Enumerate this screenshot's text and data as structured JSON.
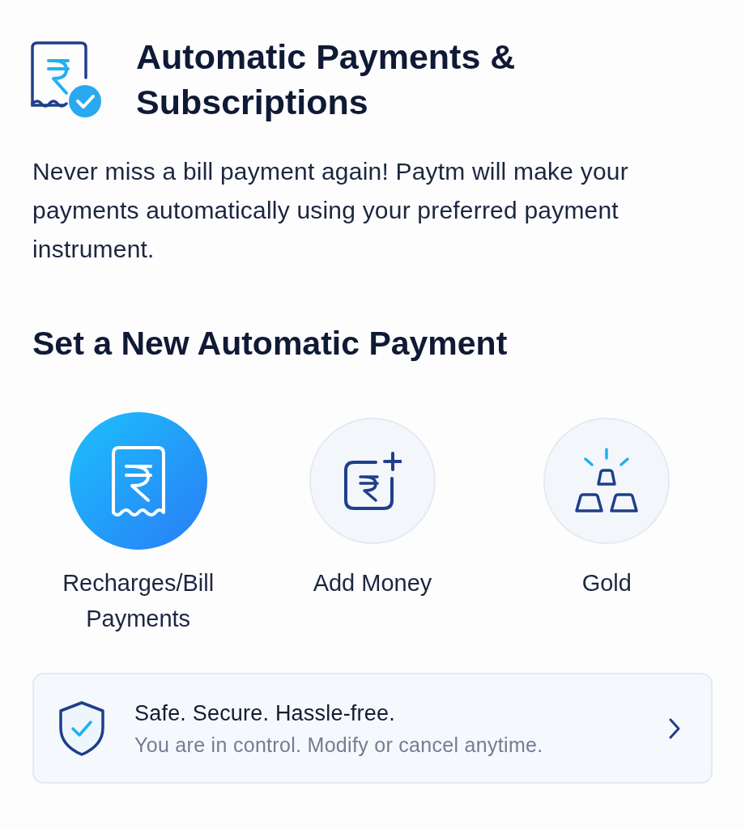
{
  "header": {
    "title": "Automatic Payments & Subscriptions"
  },
  "description": "Never miss a bill payment again! Paytm will make your payments automatically using your preferred payment instrument.",
  "section": {
    "title": "Set a New Automatic Payment"
  },
  "options": [
    {
      "kind": "bill",
      "label": "Recharges/Bill Payments",
      "selected": true
    },
    {
      "kind": "wallet",
      "label": "Add Money",
      "selected": false
    },
    {
      "kind": "gold",
      "label": "Gold",
      "selected": false
    }
  ],
  "info_card": {
    "title": "Safe. Secure. Hassle-free.",
    "subtitle": "You are in control. Modify or cancel anytime."
  }
}
